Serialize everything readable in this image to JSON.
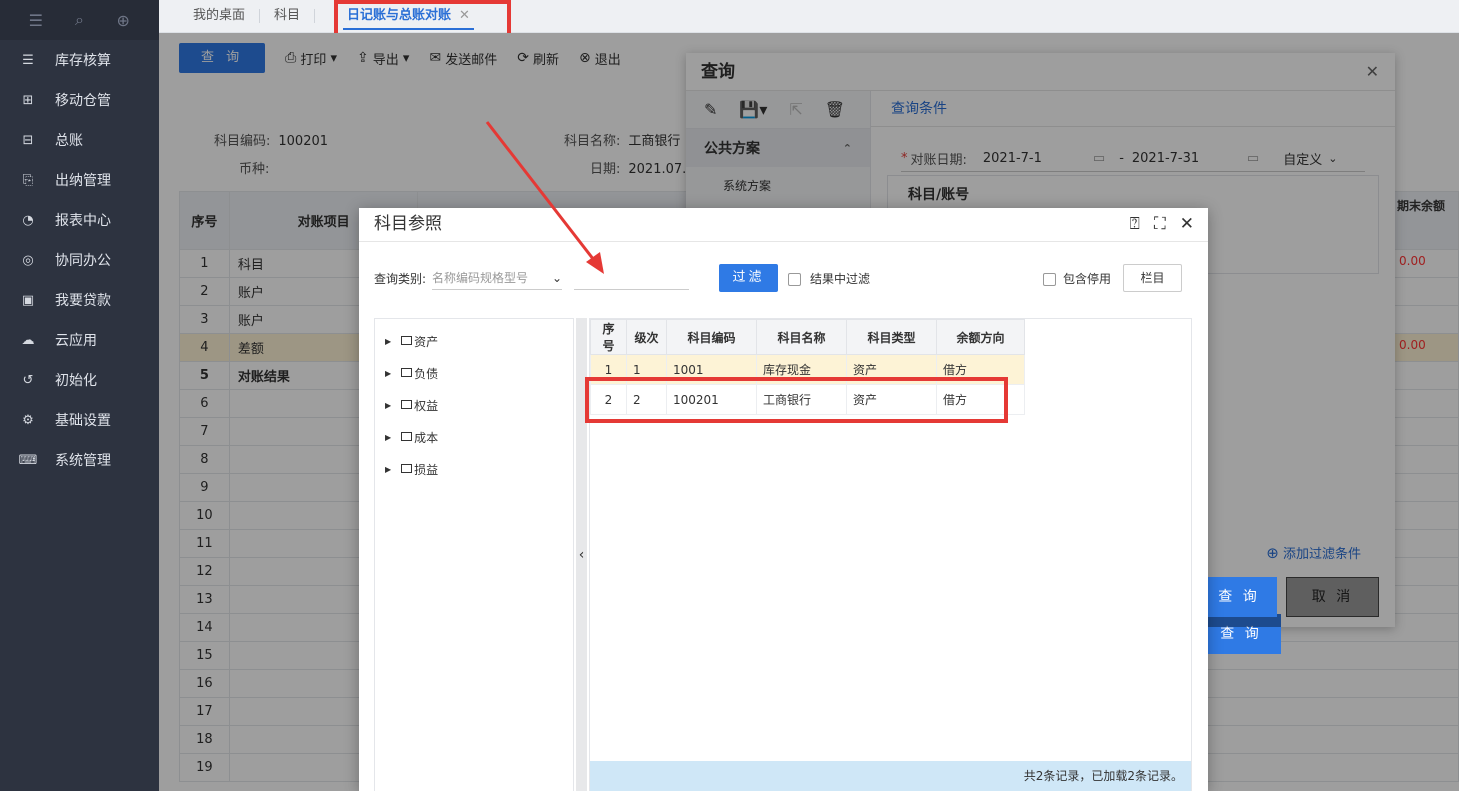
{
  "sidebar": {
    "top_icons": [
      "menu-icon",
      "search-icon",
      "add-icon"
    ],
    "items": [
      {
        "label": "库存核算",
        "icon": "inventory-icon"
      },
      {
        "label": "移动仓管",
        "icon": "grid-add-icon"
      },
      {
        "label": "总账",
        "icon": "ledger-icon"
      },
      {
        "label": "出纳管理",
        "icon": "cashier-icon"
      },
      {
        "label": "报表中心",
        "icon": "chart-pie-icon"
      },
      {
        "label": "协同办公",
        "icon": "cooperation-icon"
      },
      {
        "label": "我要贷款",
        "icon": "money-icon"
      },
      {
        "label": "云应用",
        "icon": "cloud-icon"
      },
      {
        "label": "初始化",
        "icon": "reset-icon"
      },
      {
        "label": "基础设置",
        "icon": "settings-icon"
      },
      {
        "label": "系统管理",
        "icon": "code-monitor-icon"
      }
    ]
  },
  "tabs": [
    {
      "label": "我的桌面"
    },
    {
      "label": "科目"
    },
    {
      "label": "日记账与总账对账",
      "active": true
    }
  ],
  "toolbar": {
    "query": "查 询",
    "print": "打印",
    "export": "导出",
    "send": "发送邮件",
    "refresh": "刷新",
    "exit": "退出"
  },
  "info": {
    "code_label": "科目编码:",
    "code_value": "100201",
    "currency_label": "币种:",
    "name_label": "科目名称:",
    "name_value": "工商银行",
    "date_label": "日期:",
    "date_value": "2021.07.0"
  },
  "grid": {
    "headers": [
      "序号",
      "对账项目"
    ],
    "right_header": "期末余额",
    "rows": [
      {
        "no": "1",
        "item": "科目"
      },
      {
        "no": "2",
        "item": "账户"
      },
      {
        "no": "3",
        "item": "账户"
      },
      {
        "no": "4",
        "item": "差额"
      },
      {
        "no": "5",
        "item": "对账结果"
      },
      {
        "no": "6",
        "item": ""
      },
      {
        "no": "7",
        "item": ""
      },
      {
        "no": "8",
        "item": ""
      },
      {
        "no": "9",
        "item": ""
      },
      {
        "no": "10",
        "item": ""
      },
      {
        "no": "11",
        "item": ""
      },
      {
        "no": "12",
        "item": ""
      },
      {
        "no": "13",
        "item": ""
      },
      {
        "no": "14",
        "item": ""
      },
      {
        "no": "15",
        "item": ""
      },
      {
        "no": "16",
        "item": ""
      },
      {
        "no": "17",
        "item": ""
      },
      {
        "no": "18",
        "item": ""
      },
      {
        "no": "19",
        "item": ""
      }
    ],
    "red_value": "0.00"
  },
  "query_dialog": {
    "title": "查询",
    "section": "公共方案",
    "sub_item": "系统方案",
    "head": "查询条件",
    "date_label": "对账日期:",
    "date_from": "2021-7-1",
    "date_sep": "-",
    "date_to": "2021-7-31",
    "date_mode": "自定义",
    "group_title": "科目/账号",
    "add_filter": "添加过滤条件",
    "ok": "查 询",
    "cancel": "取 消"
  },
  "ref_dialog": {
    "title": "科目参照",
    "query_type_label": "查询类别:",
    "query_type_placeholder": "名称编码规格型号",
    "filter_btn": "过滤",
    "in_result": "结果中过滤",
    "include_disabled": "包含停用",
    "columns_btn": "栏目",
    "tree": [
      "资产",
      "负债",
      "权益",
      "成本",
      "损益"
    ],
    "table_headers": [
      "序号",
      "级次",
      "科目编码",
      "科目名称",
      "科目类型",
      "余额方向"
    ],
    "rows": [
      {
        "no": "1",
        "level": "1",
        "code": "1001",
        "name": "库存现金",
        "type": "资产",
        "dir": "借方"
      },
      {
        "no": "2",
        "level": "2",
        "code": "100201",
        "name": "工商银行",
        "type": "资产",
        "dir": "借方"
      }
    ],
    "footer": "共2条记录，已加载2条记录。"
  },
  "colors": {
    "accent": "#2f7ae5",
    "highlight_row": "#fdf3d6",
    "annotation": "#e53935",
    "sidebar": "#2d3340"
  }
}
